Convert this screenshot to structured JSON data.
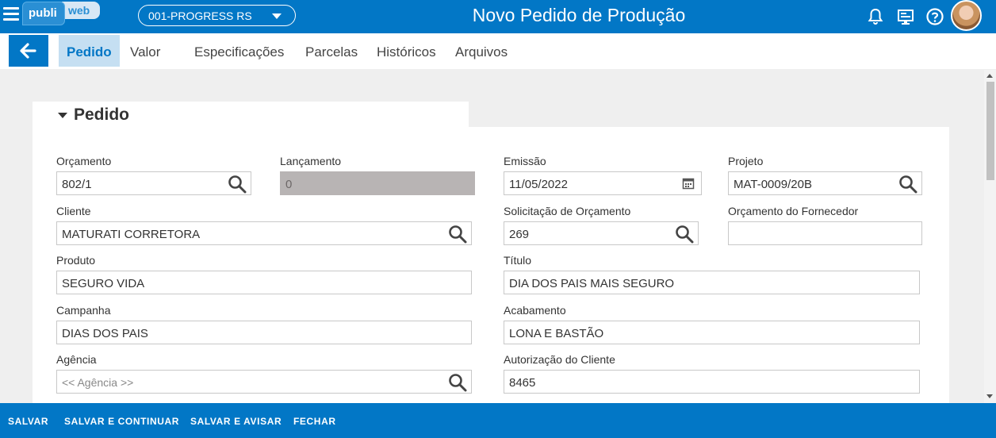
{
  "header": {
    "logo": {
      "part1": "publi",
      "part2": "web"
    },
    "company": "001-PROGRESS RS",
    "title": "Novo Pedido de Produção",
    "icons": [
      "bell-icon",
      "monitor-icon",
      "help-icon"
    ],
    "accent_color": "#0277c6"
  },
  "tabs": [
    {
      "label": "Pedido",
      "active": true
    },
    {
      "label": "Valor"
    },
    {
      "label": "Especificações"
    },
    {
      "label": "Parcelas"
    },
    {
      "label": "Históricos"
    },
    {
      "label": "Arquivos"
    }
  ],
  "section": {
    "title": "Pedido"
  },
  "form": {
    "orcamento": {
      "label": "Orçamento",
      "value": "802/1"
    },
    "lancamento": {
      "label": "Lançamento",
      "value": "0"
    },
    "emissao": {
      "label": "Emissão",
      "value": "11/05/2022"
    },
    "projeto": {
      "label": "Projeto",
      "value": "MAT-0009/20B"
    },
    "cliente": {
      "label": "Cliente",
      "value": "MATURATI CORRETORA"
    },
    "solicitacao": {
      "label": "Solicitação de Orçamento",
      "value": "269"
    },
    "orc_fornecedor": {
      "label": "Orçamento do Fornecedor",
      "value": ""
    },
    "produto": {
      "label": "Produto",
      "value": "SEGURO VIDA"
    },
    "titulo": {
      "label": "Título",
      "value": "DIA DOS PAIS MAIS SEGURO"
    },
    "campanha": {
      "label": "Campanha",
      "value": "DIAS DOS PAIS"
    },
    "acabamento": {
      "label": "Acabamento",
      "value": "LONA E BASTÃO"
    },
    "agencia": {
      "label": "Agência",
      "placeholder": "<< Agência >>"
    },
    "autorizacao": {
      "label": "Autorização do Cliente",
      "value": "8465"
    }
  },
  "footer": {
    "salvar": "SALVAR",
    "salvar_continuar": "SALVAR E CONTINUAR",
    "salvar_avisar": "SALVAR E AVISAR",
    "fechar": "FECHAR"
  }
}
